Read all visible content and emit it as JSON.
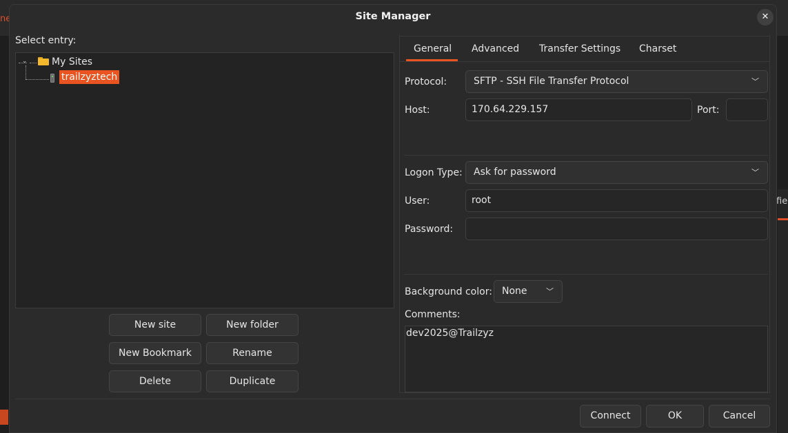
{
  "background": {
    "left_text": "ne",
    "right_text": "fie"
  },
  "dialog": {
    "title": "Site Manager",
    "close_glyph": "✕"
  },
  "left": {
    "select_entry_label": "Select entry:",
    "tree": {
      "root_label": "My Sites",
      "root_icon": "folder-icon",
      "children": [
        {
          "label": "trailzyztech",
          "icon": "server-icon",
          "selected": true
        }
      ]
    },
    "buttons": {
      "new_site": "New site",
      "new_folder": "New folder",
      "new_bookmark": "New Bookmark",
      "rename": "Rename",
      "delete": "Delete",
      "duplicate": "Duplicate"
    }
  },
  "right": {
    "tabs": [
      {
        "label": "General",
        "active": true
      },
      {
        "label": "Advanced",
        "active": false
      },
      {
        "label": "Transfer Settings",
        "active": false
      },
      {
        "label": "Charset",
        "active": false
      }
    ],
    "protocol": {
      "label": "Protocol:",
      "value": "SFTP - SSH File Transfer Protocol"
    },
    "host": {
      "label": "Host:",
      "value": "170.64.229.157"
    },
    "port": {
      "label": "Port:",
      "value": ""
    },
    "logon_type": {
      "label": "Logon Type:",
      "value": "Ask for password"
    },
    "user": {
      "label": "User:",
      "value": "root"
    },
    "password": {
      "label": "Password:",
      "value": ""
    },
    "background_color": {
      "label": "Background color:",
      "value": "None"
    },
    "comments": {
      "label": "Comments:",
      "value": "dev2025@Trailzyz"
    }
  },
  "footer": {
    "connect": "Connect",
    "ok": "OK",
    "cancel": "Cancel"
  },
  "colors": {
    "accent": "#e95420",
    "dialog_bg": "#2b2b2b",
    "field_bg": "#262626"
  }
}
